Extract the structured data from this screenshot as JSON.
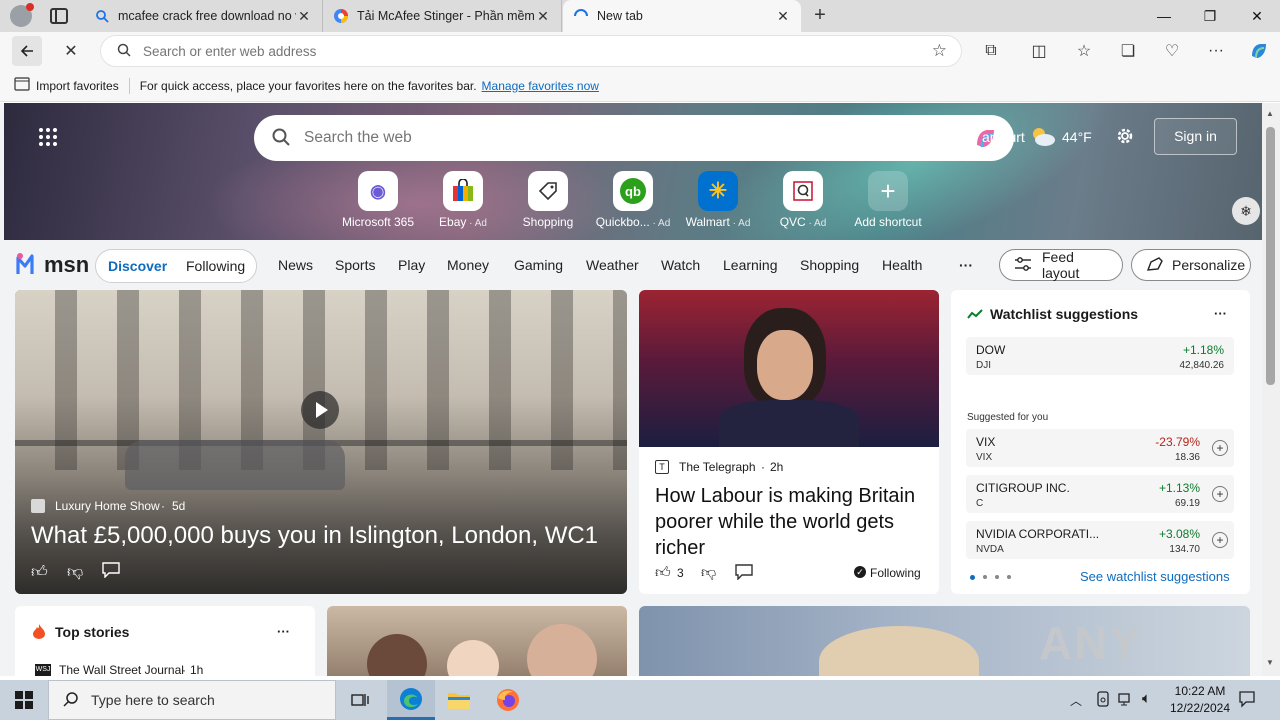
{
  "tabs": [
    {
      "label": "mcafee crack free download no v",
      "icon": "search-icon",
      "active": false
    },
    {
      "label": "Tải McAfee Stinger - Phần mềm c",
      "icon": "site-icon",
      "active": false
    },
    {
      "label": "New tab",
      "icon": "loading-icon",
      "active": true
    }
  ],
  "toolbar": {
    "address_placeholder": "Search or enter web address"
  },
  "favbar": {
    "import_label": "Import favorites",
    "message": "For quick access, place your favorites here on the favorites bar.",
    "manage_link": "Manage favorites now"
  },
  "hero": {
    "search_placeholder": "Search the web",
    "location_fragment": "ankfurt",
    "temperature": "44°F",
    "sign_in": "Sign in"
  },
  "quick_links": [
    {
      "label": "Microsoft 365",
      "ad": "",
      "icon": "microsoft365-icon",
      "color": "#6a5bd6"
    },
    {
      "label": "Ebay",
      "ad": " · Ad",
      "icon": "ebay-bag-icon",
      "color": "#e53238"
    },
    {
      "label": "Shopping",
      "ad": "",
      "icon": "shopping-tag-icon",
      "color": "#333333"
    },
    {
      "label": "Quickbo...",
      "ad": " · Ad",
      "icon": "quickbooks-icon",
      "color": "#2ca01c"
    },
    {
      "label": "Walmart",
      "ad": " · Ad",
      "icon": "walmart-icon",
      "color": "#0071ce"
    },
    {
      "label": "QVC",
      "ad": " · Ad",
      "icon": "qvc-icon",
      "color": "#c8102e"
    },
    {
      "label": "Add shortcut",
      "ad": "",
      "icon": "plus-icon",
      "color": "#ffffff"
    }
  ],
  "nav": {
    "brand": "msn",
    "discover": "Discover",
    "following": "Following",
    "items": [
      "News",
      "Sports",
      "Play",
      "Money",
      "Gaming",
      "Weather",
      "Watch",
      "Learning",
      "Shopping",
      "Health"
    ],
    "more": "···",
    "feed_layout": "Feed layout",
    "personalize": "Personalize"
  },
  "main_story": {
    "source": "Luxury Home Show",
    "age": "5d",
    "title": "What £5,000,000 buys you in Islington, London, WC1"
  },
  "second_story": {
    "source": "The Telegraph",
    "age": "2h",
    "title": "How Labour is making Britain poorer while the world gets richer",
    "likes": "3",
    "following": "Following"
  },
  "watchlist": {
    "title": "Watchlist suggestions",
    "more": "···",
    "main": {
      "name": "DOW",
      "ticker": "DJI",
      "change": "+1.18%",
      "price": "42,840.26"
    },
    "suggested_label": "Suggested for you",
    "suggestions": [
      {
        "name": "VIX",
        "ticker": "VIX",
        "change": "-23.79%",
        "price": "18.36",
        "dir": "down"
      },
      {
        "name": "CITIGROUP INC.",
        "ticker": "C",
        "change": "+1.13%",
        "price": "69.19",
        "dir": "up"
      },
      {
        "name": "NVIDIA CORPORATI...",
        "ticker": "NVDA",
        "change": "+3.08%",
        "price": "134.70",
        "dir": "up"
      }
    ],
    "see_more": "See watchlist suggestions"
  },
  "top_stories": {
    "title": "Top stories",
    "more": "···",
    "first_source": "The Wall Street Journal",
    "first_age": "1h",
    "source_badge": "WSJ"
  },
  "watermark": "ANY RUN",
  "taskbar": {
    "search_placeholder": "Type here to search",
    "time": "10:22 AM",
    "date": "12/22/2024"
  },
  "colors": {
    "accent": "#0f6cbd",
    "up": "#0a7d2c",
    "down": "#b3261e"
  }
}
